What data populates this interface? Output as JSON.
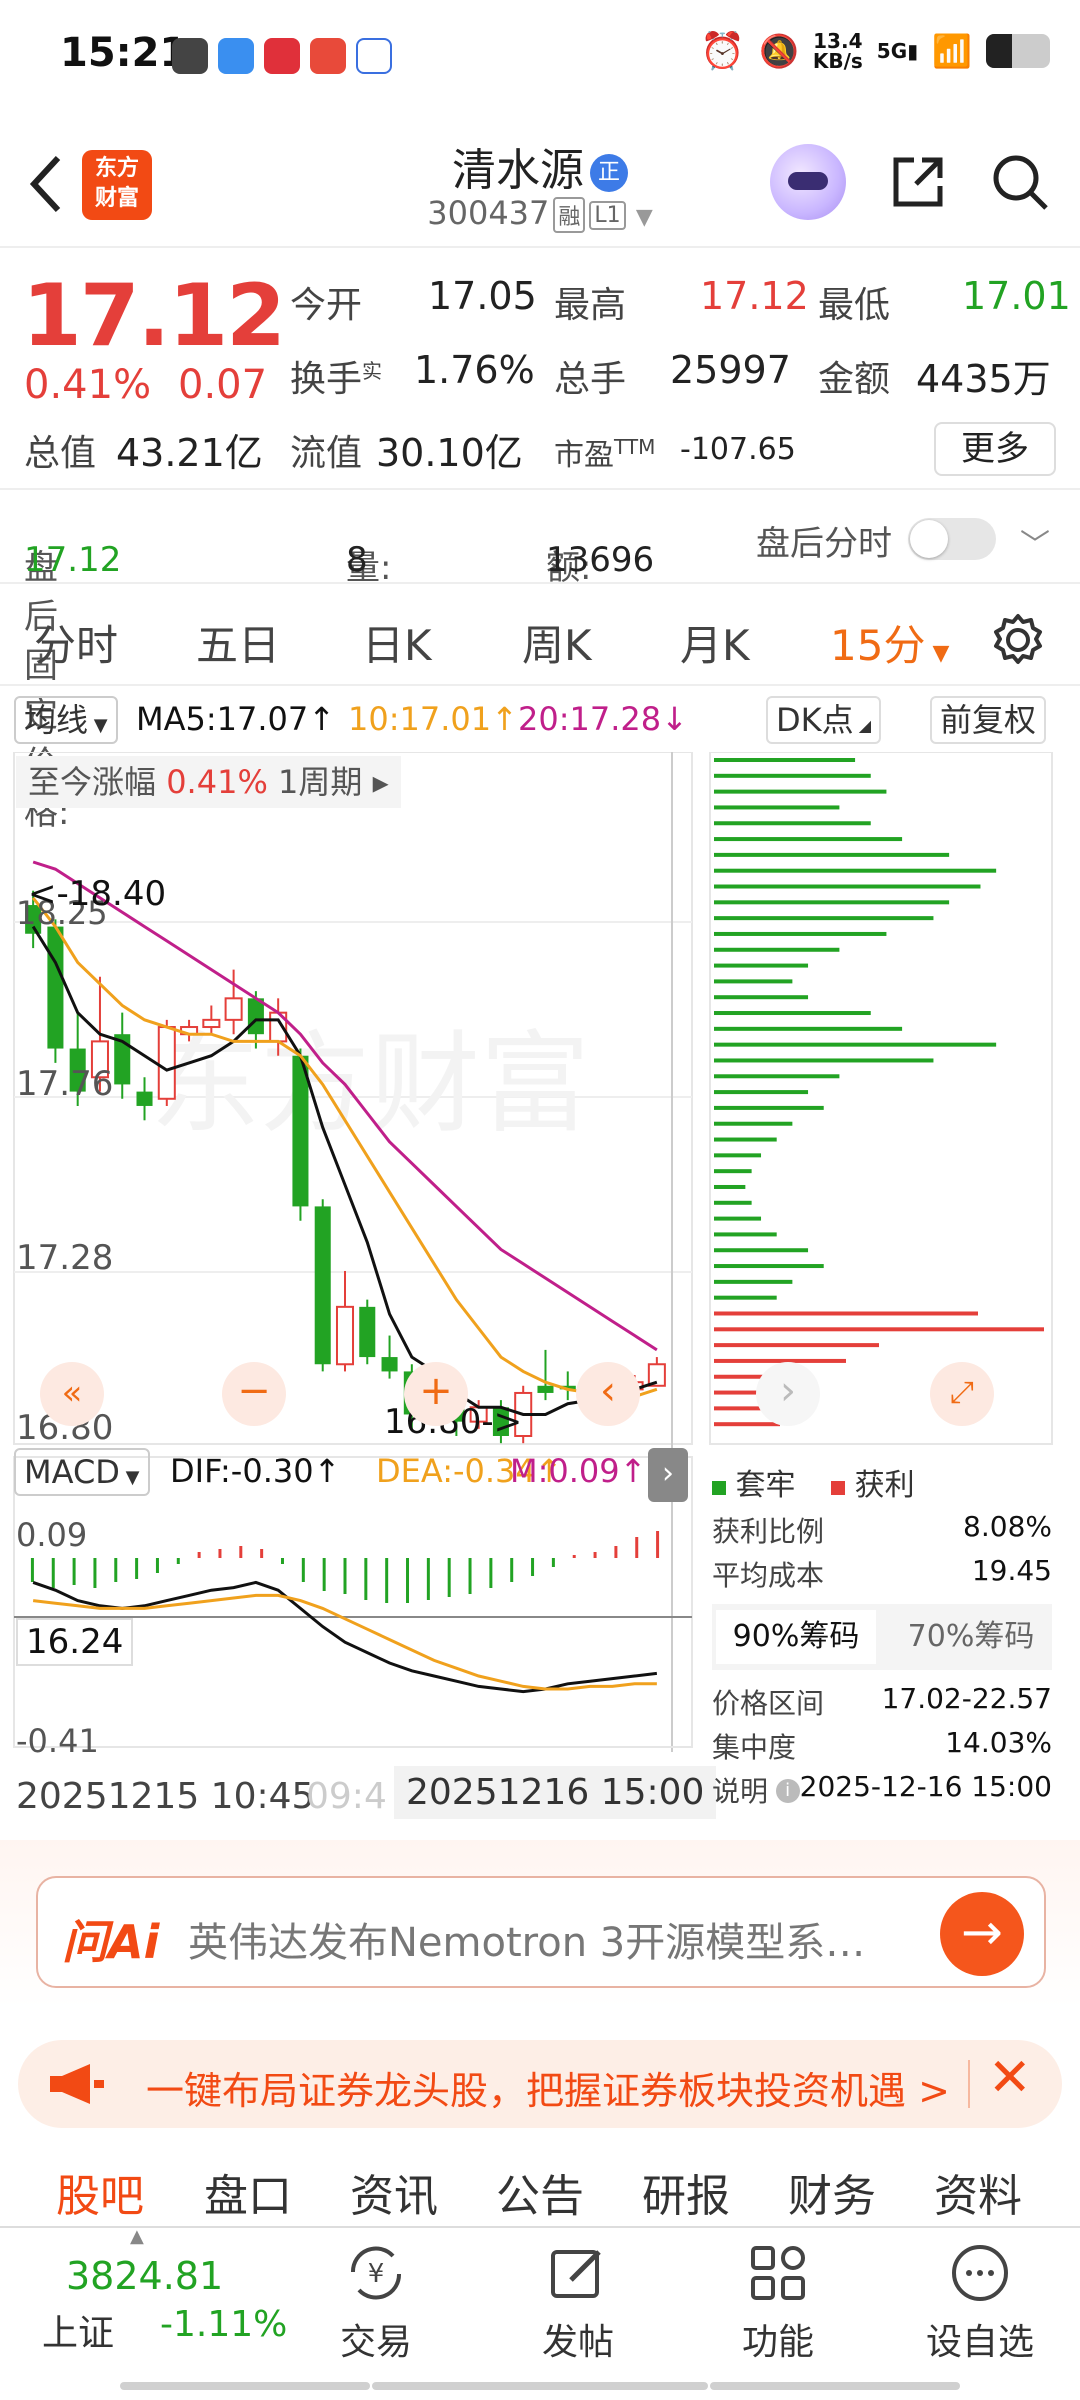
{
  "status_bar": {
    "time": "15:21",
    "net_speed": "13.4",
    "net_unit": "KB/s",
    "signal": "5G"
  },
  "header": {
    "stock_name": "清水源",
    "name_badge": "正",
    "stock_code": "300437",
    "tag_margin": "融",
    "tag_level": "L1",
    "logo_line1": "东方",
    "logo_line2": "财富"
  },
  "quote": {
    "price": "17.12",
    "change_pct": "0.41%",
    "change": "0.07",
    "open_label": "今开",
    "open": "17.05",
    "high_label": "最高",
    "high": "17.12",
    "low_label": "最低",
    "low": "17.01",
    "turnover_label": "换手",
    "turnover_sup": "实",
    "turnover": "1.76%",
    "volume_label": "总手",
    "volume": "25997",
    "amount_label": "金额",
    "amount": "4435万",
    "mktcap_label": "总值",
    "mktcap": "43.21亿",
    "float_label": "流值",
    "float": "30.10亿",
    "pe_label": "市盈",
    "pe_sup": "TTM",
    "pe": "-107.65",
    "more": "更多"
  },
  "after_hours": {
    "price_label": "盘后固定价格:",
    "price": "17.12",
    "vol_label": "量:",
    "vol": "8",
    "amt_label": "额:",
    "amt": "13696",
    "toggle_label": "盘后分时"
  },
  "tabs": [
    "分时",
    "五日",
    "日K",
    "周K",
    "月K",
    "15分"
  ],
  "chart_header": {
    "ma_select": "均线",
    "ma5": "MA5:17.07",
    "ma10": "10:17.01",
    "ma20": "20:17.28",
    "dk": "DK点",
    "adjust": "前复权"
  },
  "chart_data": {
    "type": "candlestick",
    "ylim": [
      16.8,
      18.4
    ],
    "y_ticks": [
      "18.25",
      "17.76",
      "17.28",
      "16.80"
    ],
    "max_label": "<-18.40",
    "min_label": "16.80->",
    "range_label": "至今涨幅",
    "range_value": "0.41%",
    "range_period": "1周期",
    "watermark": "东方财富",
    "candles": [
      {
        "o": 18.28,
        "c": 18.2,
        "h": 18.32,
        "l": 18.16
      },
      {
        "o": 18.22,
        "c": 17.88,
        "h": 18.24,
        "l": 17.84
      },
      {
        "o": 17.88,
        "c": 17.76,
        "h": 17.98,
        "l": 17.72
      },
      {
        "o": 17.8,
        "c": 17.9,
        "h": 18.08,
        "l": 17.76
      },
      {
        "o": 17.92,
        "c": 17.78,
        "h": 17.98,
        "l": 17.74
      },
      {
        "o": 17.76,
        "c": 17.72,
        "h": 17.8,
        "l": 17.68
      },
      {
        "o": 17.74,
        "c": 17.94,
        "h": 17.96,
        "l": 17.72
      },
      {
        "o": 17.92,
        "c": 17.94,
        "h": 17.96,
        "l": 17.9
      },
      {
        "o": 17.94,
        "c": 17.96,
        "h": 18.0,
        "l": 17.92
      },
      {
        "o": 17.96,
        "c": 18.02,
        "h": 18.1,
        "l": 17.92
      },
      {
        "o": 18.02,
        "c": 17.92,
        "h": 18.04,
        "l": 17.88
      },
      {
        "o": 17.9,
        "c": 17.98,
        "h": 18.02,
        "l": 17.86
      },
      {
        "o": 17.86,
        "c": 17.44,
        "h": 17.88,
        "l": 17.4
      },
      {
        "o": 17.44,
        "c": 17.0,
        "h": 17.46,
        "l": 16.98
      },
      {
        "o": 17.0,
        "c": 17.16,
        "h": 17.26,
        "l": 16.98
      },
      {
        "o": 17.16,
        "c": 17.02,
        "h": 17.18,
        "l": 17.0
      },
      {
        "o": 17.02,
        "c": 16.98,
        "h": 17.08,
        "l": 16.96
      },
      {
        "o": 16.98,
        "c": 16.86,
        "h": 17.0,
        "l": 16.82
      },
      {
        "o": 16.86,
        "c": 16.9,
        "h": 16.94,
        "l": 16.84
      },
      {
        "o": 16.9,
        "c": 16.84,
        "h": 16.94,
        "l": 16.8
      },
      {
        "o": 16.84,
        "c": 16.88,
        "h": 16.9,
        "l": 16.82
      },
      {
        "o": 16.88,
        "c": 16.8,
        "h": 16.9,
        "l": 16.78
      },
      {
        "o": 16.8,
        "c": 16.92,
        "h": 16.94,
        "l": 16.78
      },
      {
        "o": 16.94,
        "c": 16.92,
        "h": 17.04,
        "l": 16.9
      },
      {
        "o": 16.94,
        "c": 16.93,
        "h": 16.98,
        "l": 16.9
      },
      {
        "o": 16.93,
        "c": 16.94,
        "h": 16.96,
        "l": 16.91
      },
      {
        "o": 16.94,
        "c": 16.93,
        "h": 16.96,
        "l": 16.91
      },
      {
        "o": 16.93,
        "c": 16.95,
        "h": 16.97,
        "l": 16.91
      },
      {
        "o": 16.94,
        "c": 17.0,
        "h": 17.02,
        "l": 16.94
      }
    ],
    "ma5": [
      18.22,
      18.12,
      17.98,
      17.92,
      17.9,
      17.86,
      17.82,
      17.84,
      17.86,
      17.9,
      17.96,
      17.96,
      17.86,
      17.66,
      17.5,
      17.34,
      17.14,
      17.02,
      16.98,
      16.92,
      16.88,
      16.88,
      16.86,
      16.86,
      16.89,
      16.9,
      16.92,
      16.93,
      16.95
    ],
    "ma10": [
      18.3,
      18.22,
      18.12,
      18.06,
      18.0,
      17.96,
      17.94,
      17.92,
      17.92,
      17.9,
      17.9,
      17.9,
      17.86,
      17.78,
      17.68,
      17.58,
      17.48,
      17.38,
      17.28,
      17.18,
      17.1,
      17.02,
      16.98,
      16.95,
      16.93,
      16.92,
      16.91,
      16.91,
      16.93
    ],
    "ma20": [
      18.4,
      18.38,
      18.34,
      18.3,
      18.26,
      18.22,
      18.18,
      18.14,
      18.1,
      18.06,
      18.02,
      17.98,
      17.92,
      17.84,
      17.78,
      17.7,
      17.62,
      17.56,
      17.5,
      17.44,
      17.38,
      17.32,
      17.28,
      17.24,
      17.2,
      17.16,
      17.12,
      17.08,
      17.04
    ]
  },
  "volume_profile": {
    "legend_trapped": "套牢",
    "legend_profit": "获利",
    "green_bars": [
      0.45,
      0.5,
      0.55,
      0.4,
      0.5,
      0.6,
      0.75,
      0.9,
      0.85,
      0.75,
      0.7,
      0.55,
      0.4,
      0.3,
      0.25,
      0.3,
      0.5,
      0.6,
      0.9,
      0.7,
      0.4,
      0.3,
      0.35,
      0.25,
      0.2,
      0.15,
      0.12,
      0.1,
      0.12,
      0.15,
      0.2,
      0.3,
      0.35,
      0.25,
      0.2
    ],
    "red_bars": [
      0.8,
      1.0,
      0.5,
      0.4,
      0.3,
      0.25,
      0.3,
      0.2
    ]
  },
  "chip_info": {
    "profit_ratio_label": "获利比例",
    "profit_ratio": "8.08%",
    "avg_cost_label": "平均成本",
    "avg_cost": "19.45",
    "tab_90": "90%筹码",
    "tab_70": "70%筹码",
    "price_range_label": "价格区间",
    "price_range": "17.02-22.57",
    "concentration_label": "集中度",
    "concentration": "14.03%",
    "note_label": "说明",
    "note": "2025-12-16 15:00"
  },
  "macd": {
    "select": "MACD",
    "dif": "DIF:-0.30",
    "dea": "DEA:-0.34",
    "m": "M:0.09",
    "top": "0.09",
    "bottom": "-0.41",
    "crosshair_value": "16.24",
    "bars": [
      -0.08,
      -0.1,
      -0.09,
      -0.1,
      -0.08,
      -0.07,
      -0.05,
      -0.02,
      0.02,
      0.03,
      0.04,
      0.03,
      -0.02,
      -0.08,
      -0.11,
      -0.12,
      -0.14,
      -0.15,
      -0.15,
      -0.14,
      -0.13,
      -0.12,
      -0.1,
      -0.08,
      -0.06,
      -0.03,
      0.01,
      0.02,
      0.04,
      0.07,
      0.09
    ],
    "time_start": "20251215 10:45",
    "time_mid": "09:4",
    "time_cursor": "20251216 15:00"
  },
  "ai": {
    "logo": "问Ai",
    "text": "英伟达发布Nemotron 3开源模型系…"
  },
  "banner": {
    "text": "一键布局证券龙头股，把握证券板块投资机遇 >"
  },
  "subtabs": [
    "股吧",
    "盘口",
    "资讯",
    "公告",
    "研报",
    "财务",
    "资料"
  ],
  "dock": {
    "index_value": "3824.81",
    "index_name": "上证",
    "index_change": "-1.11%",
    "trade": "交易",
    "post": "发帖",
    "function": "功能",
    "watchlist": "设自选"
  },
  "colors": {
    "up": "#e43f3a",
    "down": "#22a323",
    "accent": "#f06b14",
    "ma5": "#111111",
    "ma10": "#f0a11d",
    "ma20": "#c01f8a"
  }
}
